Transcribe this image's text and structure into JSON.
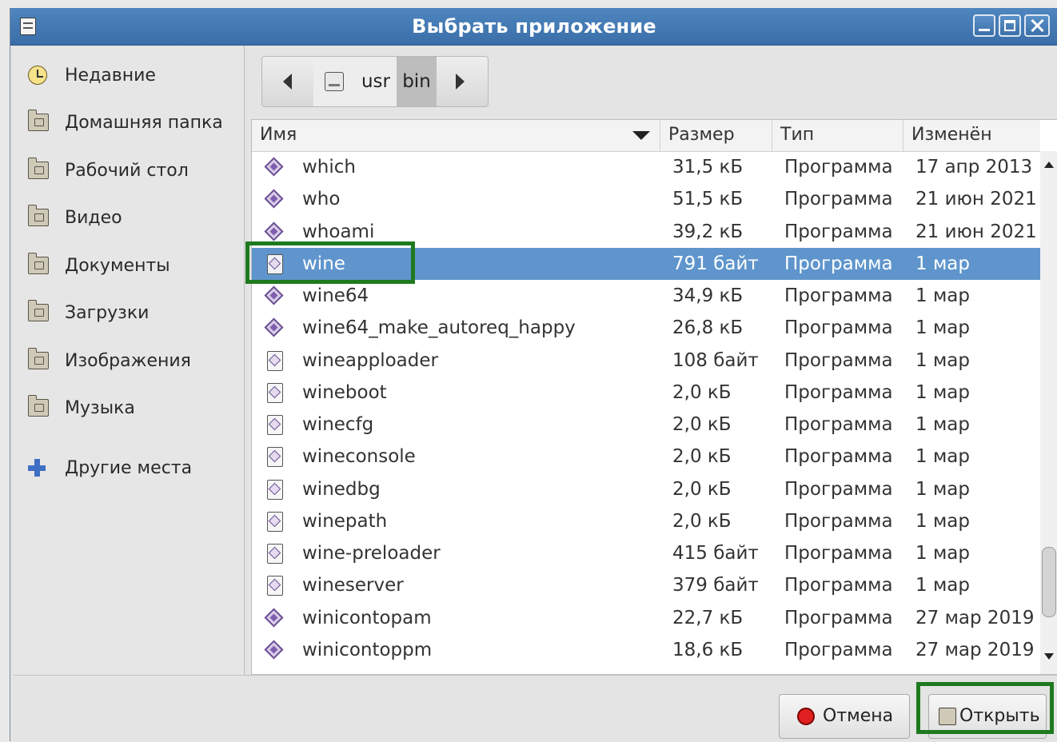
{
  "window": {
    "title": "Выбрать приложение",
    "title_color": "#3f76b2",
    "controls": [
      "minimize-icon",
      "maximize-icon",
      "close-icon"
    ]
  },
  "sidebar": {
    "items": [
      {
        "label": "Недавние",
        "icon": "recent-clock-icon"
      },
      {
        "label": "Домашняя папка",
        "icon": "home-folder-icon"
      },
      {
        "label": "Рабочий стол",
        "icon": "desktop-folder-icon"
      },
      {
        "label": "Видео",
        "icon": "video-folder-icon"
      },
      {
        "label": "Документы",
        "icon": "documents-folder-icon"
      },
      {
        "label": "Загрузки",
        "icon": "downloads-folder-icon"
      },
      {
        "label": "Изображения",
        "icon": "pictures-folder-icon"
      },
      {
        "label": "Музыка",
        "icon": "music-folder-icon"
      },
      {
        "label": "Другие места",
        "icon": "plus-icon"
      }
    ]
  },
  "pathbar": {
    "segments": [
      "usr",
      "bin"
    ],
    "active": "bin"
  },
  "table": {
    "columns": [
      "Имя",
      "Размер",
      "Тип",
      "Изменён"
    ],
    "sort_column": "Имя",
    "rows": [
      {
        "name": "which",
        "size": "31,5 кБ",
        "type": "Программа",
        "modified": "17 апр 2013",
        "icon": "executable-icon"
      },
      {
        "name": "who",
        "size": "51,5 кБ",
        "type": "Программа",
        "modified": "21 июн 2021",
        "icon": "executable-icon"
      },
      {
        "name": "whoami",
        "size": "39,2 кБ",
        "type": "Программа",
        "modified": "21 июн 2021",
        "icon": "executable-icon"
      },
      {
        "name": "wine",
        "size": "791 байт",
        "type": "Программа",
        "modified": "1 мар",
        "icon": "script-icon",
        "selected": true
      },
      {
        "name": "wine64",
        "size": "34,9 кБ",
        "type": "Программа",
        "modified": "1 мар",
        "icon": "executable-icon"
      },
      {
        "name": "wine64_make_autoreq_happy",
        "size": "26,8 кБ",
        "type": "Программа",
        "modified": "1 мар",
        "icon": "executable-icon"
      },
      {
        "name": "wineapploader",
        "size": "108 байт",
        "type": "Программа",
        "modified": "1 мар",
        "icon": "script-icon"
      },
      {
        "name": "wineboot",
        "size": "2,0 кБ",
        "type": "Программа",
        "modified": "1 мар",
        "icon": "script-icon"
      },
      {
        "name": "winecfg",
        "size": "2,0 кБ",
        "type": "Программа",
        "modified": "1 мар",
        "icon": "script-icon"
      },
      {
        "name": "wineconsole",
        "size": "2,0 кБ",
        "type": "Программа",
        "modified": "1 мар",
        "icon": "script-icon"
      },
      {
        "name": "winedbg",
        "size": "2,0 кБ",
        "type": "Программа",
        "modified": "1 мар",
        "icon": "script-icon"
      },
      {
        "name": "winepath",
        "size": "2,0 кБ",
        "type": "Программа",
        "modified": "1 мар",
        "icon": "script-icon"
      },
      {
        "name": "wine-preloader",
        "size": "415 байт",
        "type": "Программа",
        "modified": "1 мар",
        "icon": "script-icon"
      },
      {
        "name": "wineserver",
        "size": "379 байт",
        "type": "Программа",
        "modified": "1 мар",
        "icon": "script-icon"
      },
      {
        "name": "winicontopam",
        "size": "22,7 кБ",
        "type": "Программа",
        "modified": "27 мар 2019",
        "icon": "executable-icon"
      },
      {
        "name": "winicontoppm",
        "size": "18,6 кБ",
        "type": "Программа",
        "modified": "27 мар 2019",
        "icon": "executable-icon"
      }
    ],
    "selected_color": "#5f95cc"
  },
  "buttons": {
    "cancel_label": "Отмена",
    "open_label": "Открыть"
  },
  "highlight_color": "#1e7a1e"
}
